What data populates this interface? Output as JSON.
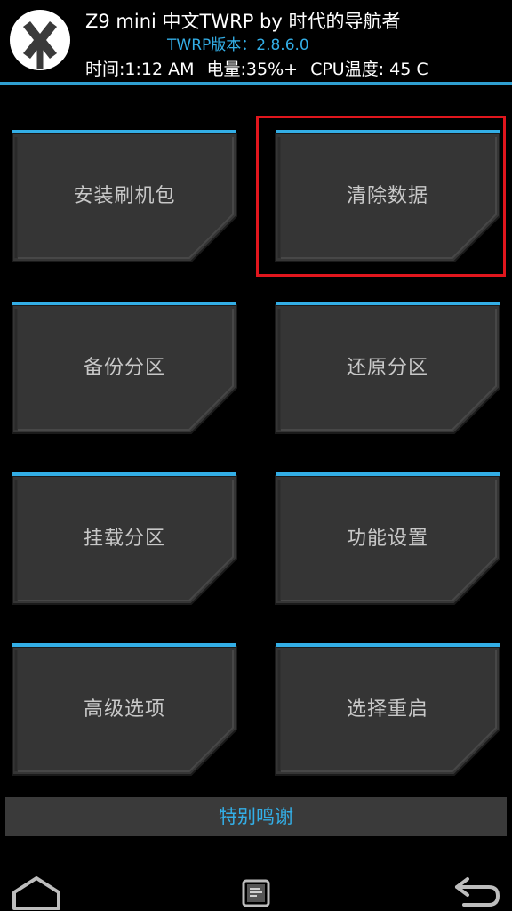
{
  "header": {
    "title": "Z9 mini 中文TWRP by 时代的导航者",
    "version": "TWRP版本：2.8.6.0",
    "time": "时间:1:12 AM",
    "battery": "电量:35%+",
    "cpu_temp": "CPU温度: 45 C",
    "logo_icon": "twrp-logo-icon"
  },
  "menu": {
    "install": "安装刷机包",
    "wipe": "清除数据",
    "backup": "备份分区",
    "restore": "还原分区",
    "mount": "挂载分区",
    "settings": "功能设置",
    "advanced": "高级选项",
    "reboot": "选择重启"
  },
  "credits": "特别鸣谢",
  "navbar": {
    "home_icon": "home-icon",
    "console_icon": "console-icon",
    "back_icon": "back-icon"
  },
  "colors": {
    "accent": "#33aee6",
    "highlight": "#e0161d",
    "tile": "#3a3a3a"
  }
}
